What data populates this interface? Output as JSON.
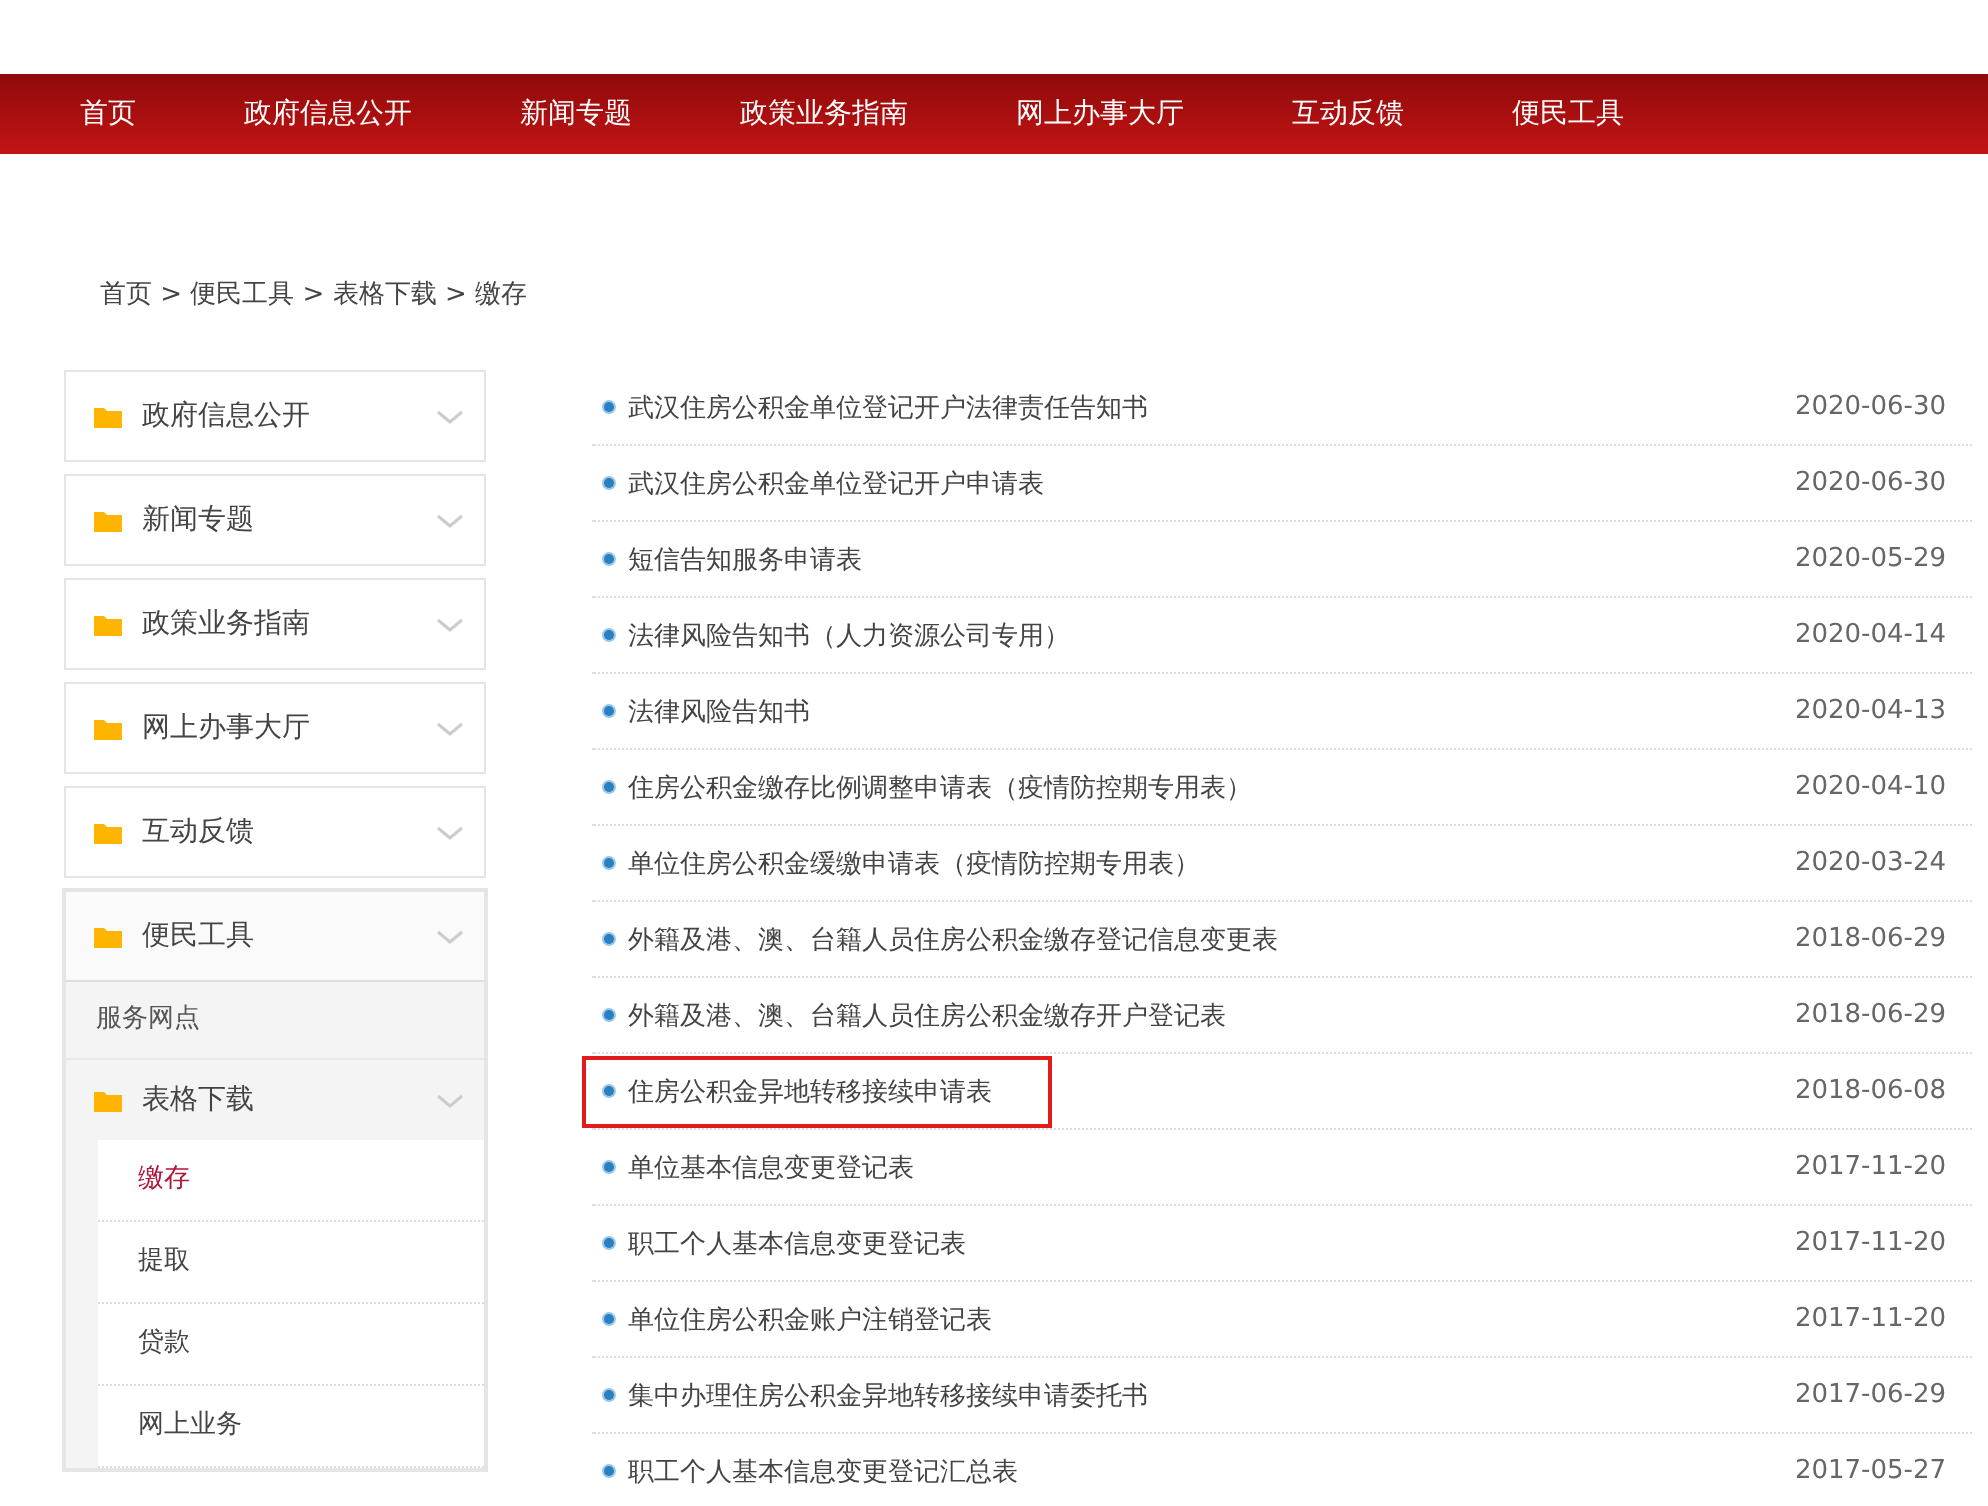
{
  "nav": [
    {
      "label": "首页"
    },
    {
      "label": "政府信息公开"
    },
    {
      "label": "新闻专题"
    },
    {
      "label": "政策业务指南"
    },
    {
      "label": "网上办事大厅"
    },
    {
      "label": "互动反馈"
    },
    {
      "label": "便民工具"
    }
  ],
  "breadcrumb": "首页 > 便民工具 > 表格下载 > 缴存",
  "sidebar": {
    "items": [
      {
        "label": "政府信息公开",
        "expanded": false
      },
      {
        "label": "新闻专题",
        "expanded": false
      },
      {
        "label": "政策业务指南",
        "expanded": false
      },
      {
        "label": "网上办事大厅",
        "expanded": false
      },
      {
        "label": "互动反馈",
        "expanded": false
      },
      {
        "label": "便民工具",
        "expanded": true,
        "children": [
          {
            "label": "服务网点",
            "kind": "link"
          },
          {
            "label": "表格下载",
            "kind": "folder",
            "expanded": true,
            "children": [
              {
                "label": "缴存",
                "selected": true
              },
              {
                "label": "提取",
                "selected": false
              },
              {
                "label": "贷款",
                "selected": false
              },
              {
                "label": "网上业务",
                "selected": false
              }
            ]
          }
        ]
      }
    ]
  },
  "documents": [
    {
      "title": "武汉住房公积金单位登记开户法律责任告知书",
      "date": "2020-06-30",
      "highlighted": false
    },
    {
      "title": "武汉住房公积金单位登记开户申请表",
      "date": "2020-06-30",
      "highlighted": false
    },
    {
      "title": "短信告知服务申请表",
      "date": "2020-05-29",
      "highlighted": false
    },
    {
      "title": "法律风险告知书（人力资源公司专用）",
      "date": "2020-04-14",
      "highlighted": false
    },
    {
      "title": "法律风险告知书",
      "date": "2020-04-13",
      "highlighted": false
    },
    {
      "title": "住房公积金缴存比例调整申请表（疫情防控期专用表）",
      "date": "2020-04-10",
      "highlighted": false
    },
    {
      "title": "单位住房公积金缓缴申请表（疫情防控期专用表）",
      "date": "2020-03-24",
      "highlighted": false
    },
    {
      "title": "外籍及港、澳、台籍人员住房公积金缴存登记信息变更表",
      "date": "2018-06-29",
      "highlighted": false
    },
    {
      "title": "外籍及港、澳、台籍人员住房公积金缴存开户登记表",
      "date": "2018-06-29",
      "highlighted": false
    },
    {
      "title": "住房公积金异地转移接续申请表",
      "date": "2018-06-08",
      "highlighted": true
    },
    {
      "title": "单位基本信息变更登记表",
      "date": "2017-11-20",
      "highlighted": false
    },
    {
      "title": "职工个人基本信息变更登记表",
      "date": "2017-11-20",
      "highlighted": false
    },
    {
      "title": "单位住房公积金账户注销登记表",
      "date": "2017-11-20",
      "highlighted": false
    },
    {
      "title": "集中办理住房公积金异地转移接续申请委托书",
      "date": "2017-06-29",
      "highlighted": false
    },
    {
      "title": "职工个人基本信息变更登记汇总表",
      "date": "2017-05-27",
      "highlighted": false
    }
  ]
}
